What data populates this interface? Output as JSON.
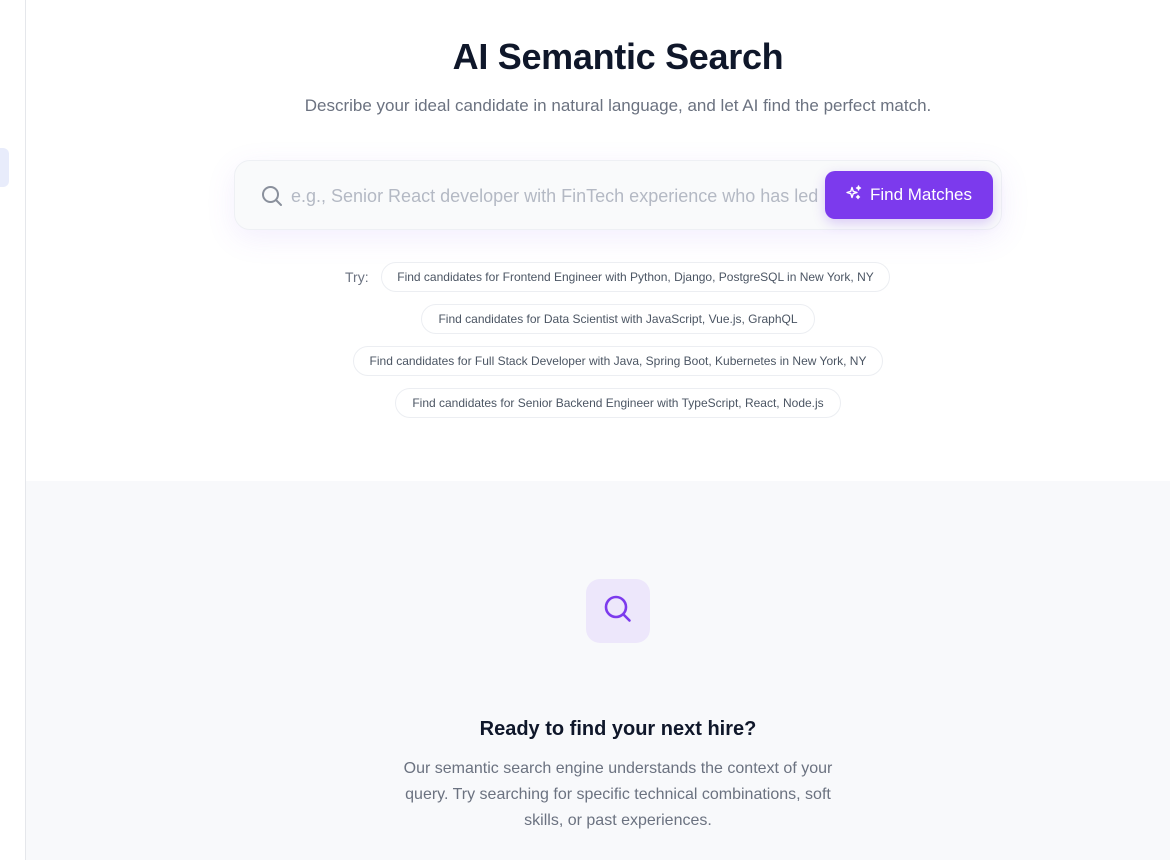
{
  "hero": {
    "title": "AI Semantic Search",
    "subtitle": "Describe your ideal candidate in natural language, and let AI find the perfect match."
  },
  "search": {
    "placeholder": "e.g., Senior React developer with FinTech experience who has led",
    "value": "",
    "button_label": "Find Matches",
    "accent": "#7c3aed"
  },
  "suggestions": {
    "label": "Try:",
    "items": [
      "Find candidates for Frontend Engineer with Python, Django, PostgreSQL in New York, NY",
      "Find candidates for Data Scientist with JavaScript, Vue.js, GraphQL",
      "Find candidates for Full Stack Developer with Java, Spring Boot, Kubernetes in New York, NY",
      "Find candidates for Senior Backend Engineer with TypeScript, React, Node.js"
    ]
  },
  "empty_state": {
    "icon": "search-icon",
    "title": "Ready to find your next hire?",
    "description": "Our semantic search engine understands the context of your query. Try searching for specific technical combinations, soft skills, or past experiences."
  }
}
